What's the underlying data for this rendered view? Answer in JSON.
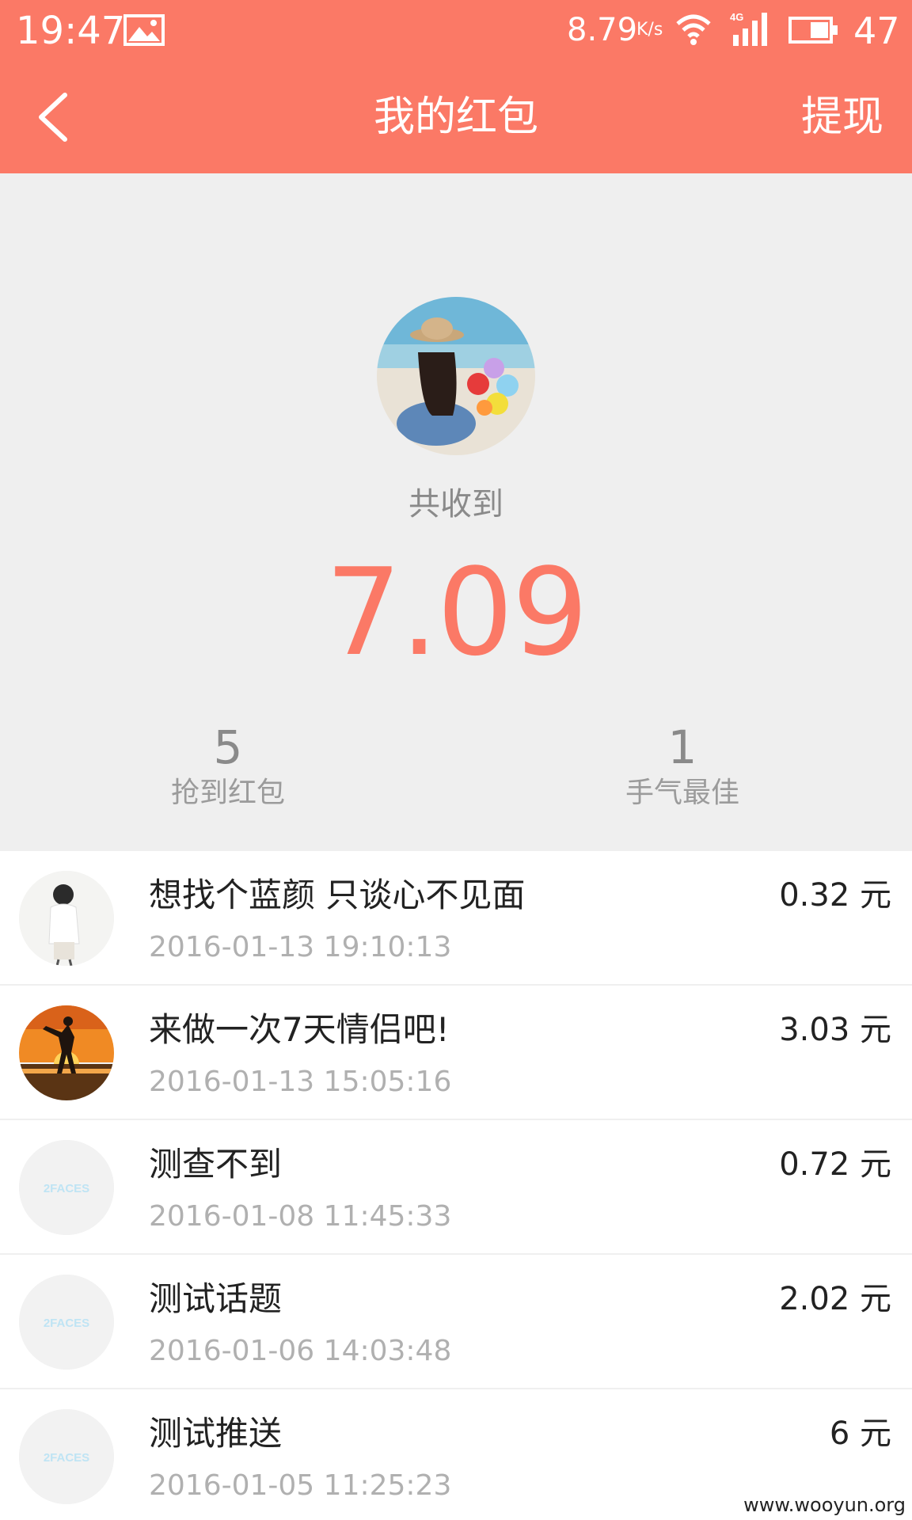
{
  "status_bar": {
    "time": "19:47",
    "net_speed": "8.79",
    "net_speed_unit": "K/s",
    "network_type": "4G",
    "battery_level": "47",
    "icons": [
      "gallery-icon",
      "wifi-icon",
      "signal-icon",
      "battery-icon"
    ]
  },
  "app_bar": {
    "title": "我的红包",
    "withdraw_label": "提现",
    "back_icon": "back-chevron-icon"
  },
  "summary": {
    "total_label": "共收到",
    "total_amount": "7.09",
    "stats": [
      {
        "value": "5",
        "label": "抢到红包"
      },
      {
        "value": "1",
        "label": "手气最佳"
      }
    ]
  },
  "records": [
    {
      "title": "想找个蓝颜 只谈心不见面",
      "time": "2016-01-13 19:10:13",
      "amount": "0.32",
      "avatar": "user-photo"
    },
    {
      "title": "来做一次7天情侣吧!",
      "time": "2016-01-13 15:05:16",
      "amount": "3.03",
      "avatar": "sunset-photo"
    },
    {
      "title": "测查不到",
      "time": "2016-01-08 11:45:33",
      "amount": "0.72",
      "avatar": "2faces-logo"
    },
    {
      "title": "测试话题",
      "time": "2016-01-06 14:03:48",
      "amount": "2.02",
      "avatar": "2faces-logo"
    },
    {
      "title": "测试推送",
      "time": "2016-01-05 11:25:23",
      "amount": "6",
      "avatar": "2faces-logo"
    }
  ],
  "currency_unit": "元",
  "logo_text": "2FACES",
  "watermark": "www.wooyun.org",
  "colors": {
    "accent": "#fb7966",
    "summary_bg": "#efefef",
    "muted_text": "#8a8a8a",
    "time_text": "#b0b0b0"
  }
}
